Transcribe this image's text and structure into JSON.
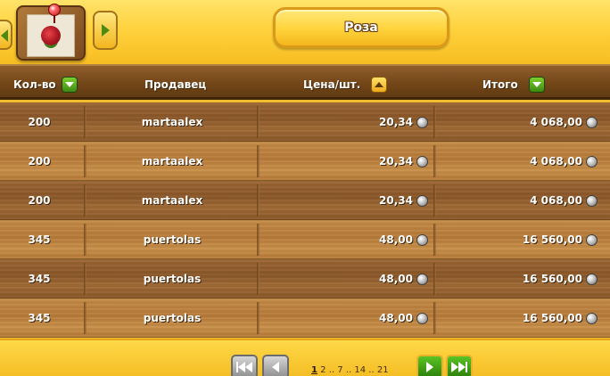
{
  "item": {
    "title": "Роза",
    "icon": "rose-icon"
  },
  "table": {
    "headers": {
      "quantity": "Кол-во",
      "seller": "Продавец",
      "price": "Цена/шт.",
      "total": "Итого"
    },
    "sort": {
      "quantity": "descending",
      "price": "ascending",
      "total": "descending",
      "active_column": "price"
    },
    "rows": [
      {
        "quantity": "200",
        "seller": "martaalex",
        "price": "20,34",
        "total": "4 068,00"
      },
      {
        "quantity": "200",
        "seller": "martaalex",
        "price": "20,34",
        "total": "4 068,00"
      },
      {
        "quantity": "200",
        "seller": "martaalex",
        "price": "20,34",
        "total": "4 068,00"
      },
      {
        "quantity": "345",
        "seller": "puertolas",
        "price": "48,00",
        "total": "16 560,00"
      },
      {
        "quantity": "345",
        "seller": "puertolas",
        "price": "48,00",
        "total": "16 560,00"
      },
      {
        "quantity": "345",
        "seller": "puertolas",
        "price": "48,00",
        "total": "16 560,00"
      }
    ]
  },
  "pagination": {
    "current": "1",
    "pages": [
      "2",
      "..",
      "7",
      "..",
      "14",
      "..",
      "21"
    ]
  },
  "colors": {
    "background": "#f2bd2c",
    "wood_dark": "#8a5728",
    "wood_light": "#b77b3a",
    "accent_green": "#3c8a14"
  }
}
